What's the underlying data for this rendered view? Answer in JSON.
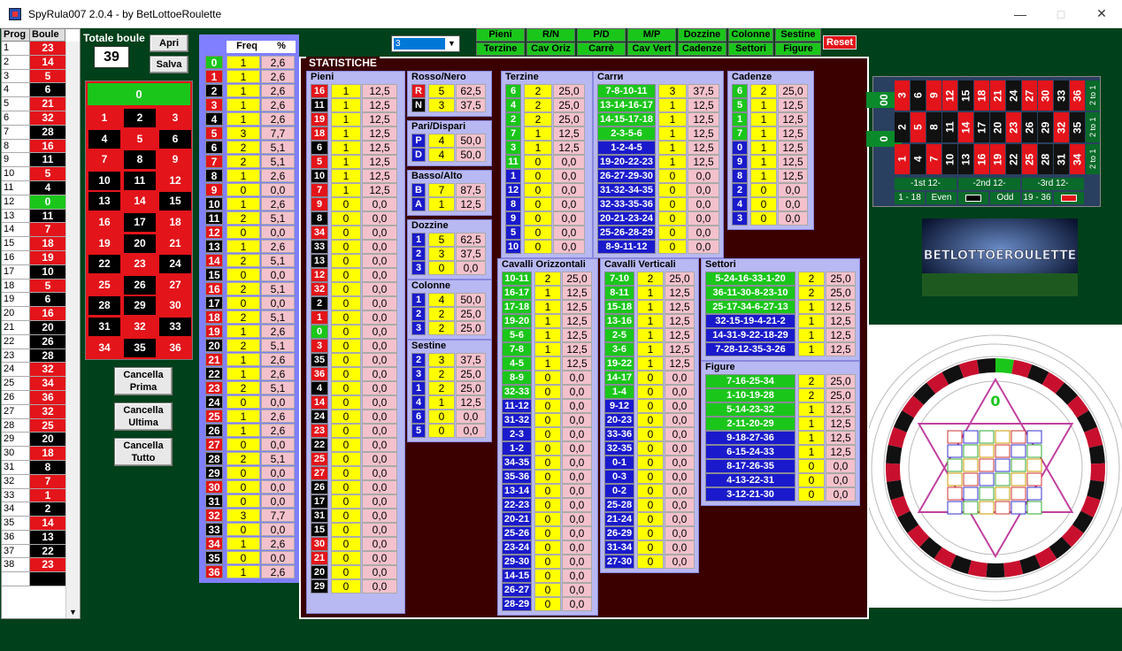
{
  "window": {
    "title": "SpyRula007 2.0.4 - by BetLottoeRoulette"
  },
  "left_grid": {
    "headers": [
      "Prog",
      "Boule"
    ],
    "rows": [
      [
        "1",
        "23",
        "r"
      ],
      [
        "2",
        "14",
        "r"
      ],
      [
        "3",
        "5",
        "r"
      ],
      [
        "4",
        "6",
        "b"
      ],
      [
        "5",
        "21",
        "r"
      ],
      [
        "6",
        "32",
        "r"
      ],
      [
        "7",
        "28",
        "b"
      ],
      [
        "8",
        "16",
        "r"
      ],
      [
        "9",
        "11",
        "b"
      ],
      [
        "10",
        "5",
        "r"
      ],
      [
        "11",
        "4",
        "b"
      ],
      [
        "12",
        "0",
        "g"
      ],
      [
        "13",
        "11",
        "b"
      ],
      [
        "14",
        "7",
        "r"
      ],
      [
        "15",
        "18",
        "r"
      ],
      [
        "16",
        "19",
        "r"
      ],
      [
        "17",
        "10",
        "b"
      ],
      [
        "18",
        "5",
        "r"
      ],
      [
        "19",
        "6",
        "b"
      ],
      [
        "20",
        "16",
        "r"
      ],
      [
        "21",
        "20",
        "b"
      ],
      [
        "22",
        "26",
        "b"
      ],
      [
        "23",
        "28",
        "b"
      ],
      [
        "24",
        "32",
        "r"
      ],
      [
        "25",
        "34",
        "r"
      ],
      [
        "26",
        "36",
        "r"
      ],
      [
        "27",
        "32",
        "r"
      ],
      [
        "28",
        "25",
        "r"
      ],
      [
        "29",
        "20",
        "b"
      ],
      [
        "30",
        "18",
        "r"
      ],
      [
        "31",
        "8",
        "b"
      ],
      [
        "32",
        "7",
        "r"
      ],
      [
        "33",
        "1",
        "r"
      ],
      [
        "34",
        "2",
        "b"
      ],
      [
        "35",
        "14",
        "r"
      ],
      [
        "36",
        "13",
        "b"
      ],
      [
        "37",
        "22",
        "b"
      ],
      [
        "38",
        "23",
        "r"
      ]
    ]
  },
  "controls": {
    "totale_label": "Totale boule",
    "totale_value": "39",
    "apri": "Apri",
    "salva": "Salva",
    "cancella_prima": "Cancella\nPrima",
    "cancella_ultima": "Cancella\nUltima",
    "cancella_tutto": "Cancella\nTutto"
  },
  "board": {
    "zero": "0",
    "rows": [
      [
        "1",
        "r"
      ],
      [
        "2",
        "b"
      ],
      [
        "3",
        "r"
      ],
      [
        "4",
        "b"
      ],
      [
        "5",
        "r"
      ],
      [
        "6",
        "b"
      ],
      [
        "7",
        "r"
      ],
      [
        "8",
        "b"
      ],
      [
        "9",
        "r"
      ],
      [
        "10",
        "b"
      ],
      [
        "11",
        "b"
      ],
      [
        "12",
        "r"
      ],
      [
        "13",
        "b"
      ],
      [
        "14",
        "r"
      ],
      [
        "15",
        "b"
      ],
      [
        "16",
        "r"
      ],
      [
        "17",
        "b"
      ],
      [
        "18",
        "r"
      ],
      [
        "19",
        "r"
      ],
      [
        "20",
        "b"
      ],
      [
        "21",
        "r"
      ],
      [
        "22",
        "b"
      ],
      [
        "23",
        "r"
      ],
      [
        "24",
        "b"
      ],
      [
        "25",
        "r"
      ],
      [
        "26",
        "b"
      ],
      [
        "27",
        "r"
      ],
      [
        "28",
        "b"
      ],
      [
        "29",
        "b"
      ],
      [
        "30",
        "r"
      ],
      [
        "31",
        "b"
      ],
      [
        "32",
        "r"
      ],
      [
        "33",
        "b"
      ],
      [
        "34",
        "r"
      ],
      [
        "35",
        "b"
      ],
      [
        "36",
        "r"
      ]
    ]
  },
  "freq": {
    "headers": [
      "Freq",
      "%"
    ],
    "rows": [
      [
        "0",
        "1",
        "2,6",
        "g"
      ],
      [
        "1",
        "1",
        "2,6",
        "r"
      ],
      [
        "2",
        "1",
        "2,6",
        "b"
      ],
      [
        "3",
        "1",
        "2,6",
        "r"
      ],
      [
        "4",
        "1",
        "2,6",
        "b"
      ],
      [
        "5",
        "3",
        "7,7",
        "r"
      ],
      [
        "6",
        "2",
        "5,1",
        "b"
      ],
      [
        "7",
        "2",
        "5,1",
        "r"
      ],
      [
        "8",
        "1",
        "2,6",
        "b"
      ],
      [
        "9",
        "0",
        "0,0",
        "r"
      ],
      [
        "10",
        "1",
        "2,6",
        "b"
      ],
      [
        "11",
        "2",
        "5,1",
        "b"
      ],
      [
        "12",
        "0",
        "0,0",
        "r"
      ],
      [
        "13",
        "1",
        "2,6",
        "b"
      ],
      [
        "14",
        "2",
        "5,1",
        "r"
      ],
      [
        "15",
        "0",
        "0,0",
        "b"
      ],
      [
        "16",
        "2",
        "5,1",
        "r"
      ],
      [
        "17",
        "0",
        "0,0",
        "b"
      ],
      [
        "18",
        "2",
        "5,1",
        "r"
      ],
      [
        "19",
        "1",
        "2,6",
        "r"
      ],
      [
        "20",
        "2",
        "5,1",
        "b"
      ],
      [
        "21",
        "1",
        "2,6",
        "r"
      ],
      [
        "22",
        "1",
        "2,6",
        "b"
      ],
      [
        "23",
        "2",
        "5,1",
        "r"
      ],
      [
        "24",
        "0",
        "0,0",
        "b"
      ],
      [
        "25",
        "1",
        "2,6",
        "r"
      ],
      [
        "26",
        "1",
        "2,6",
        "b"
      ],
      [
        "27",
        "0",
        "0,0",
        "r"
      ],
      [
        "28",
        "2",
        "5,1",
        "b"
      ],
      [
        "29",
        "0",
        "0,0",
        "b"
      ],
      [
        "30",
        "0",
        "0,0",
        "r"
      ],
      [
        "31",
        "0",
        "0,0",
        "b"
      ],
      [
        "32",
        "3",
        "7,7",
        "r"
      ],
      [
        "33",
        "0",
        "0,0",
        "b"
      ],
      [
        "34",
        "1",
        "2,6",
        "r"
      ],
      [
        "35",
        "0",
        "0,0",
        "b"
      ],
      [
        "36",
        "1",
        "2,6",
        "r"
      ]
    ]
  },
  "combo": {
    "value": "3"
  },
  "nav_buttons": [
    [
      "Pieni",
      "Terzine"
    ],
    [
      "R/N",
      "Cav Oriz"
    ],
    [
      "P/D",
      "Carrè"
    ],
    [
      "M/P",
      "Cav Vert"
    ],
    [
      "Dozzine",
      "Cadenze"
    ],
    [
      "Colonne",
      "Settori"
    ],
    [
      "Sestine",
      "Figure"
    ]
  ],
  "reset": "Reset",
  "stat_label": "STATISTICHE",
  "pieni": {
    "title": "Pieni",
    "rows": [
      [
        "16",
        "1",
        "12,5",
        "r"
      ],
      [
        "11",
        "1",
        "12,5",
        "b"
      ],
      [
        "19",
        "1",
        "12,5",
        "r"
      ],
      [
        "18",
        "1",
        "12,5",
        "r"
      ],
      [
        "6",
        "1",
        "12,5",
        "b"
      ],
      [
        "5",
        "1",
        "12,5",
        "r"
      ],
      [
        "10",
        "1",
        "12,5",
        "b"
      ],
      [
        "7",
        "1",
        "12,5",
        "r"
      ],
      [
        "9",
        "0",
        "0,0",
        "r"
      ],
      [
        "8",
        "0",
        "0,0",
        "b"
      ],
      [
        "34",
        "0",
        "0,0",
        "r"
      ],
      [
        "33",
        "0",
        "0,0",
        "b"
      ],
      [
        "13",
        "0",
        "0,0",
        "b"
      ],
      [
        "12",
        "0",
        "0,0",
        "r"
      ],
      [
        "32",
        "0",
        "0,0",
        "r"
      ],
      [
        "2",
        "0",
        "0,0",
        "b"
      ],
      [
        "1",
        "0",
        "0,0",
        "r"
      ],
      [
        "0",
        "0",
        "0,0",
        "g"
      ],
      [
        "3",
        "0",
        "0,0",
        "r"
      ],
      [
        "35",
        "0",
        "0,0",
        "b"
      ],
      [
        "36",
        "0",
        "0,0",
        "r"
      ],
      [
        "4",
        "0",
        "0,0",
        "b"
      ],
      [
        "14",
        "0",
        "0,0",
        "r"
      ],
      [
        "24",
        "0",
        "0,0",
        "b"
      ],
      [
        "23",
        "0",
        "0,0",
        "r"
      ],
      [
        "22",
        "0",
        "0,0",
        "b"
      ],
      [
        "25",
        "0",
        "0,0",
        "r"
      ],
      [
        "27",
        "0",
        "0,0",
        "r"
      ],
      [
        "26",
        "0",
        "0,0",
        "b"
      ],
      [
        "17",
        "0",
        "0,0",
        "b"
      ],
      [
        "31",
        "0",
        "0,0",
        "b"
      ],
      [
        "15",
        "0",
        "0,0",
        "b"
      ],
      [
        "30",
        "0",
        "0,0",
        "r"
      ],
      [
        "21",
        "0",
        "0,0",
        "r"
      ],
      [
        "20",
        "0",
        "0,0",
        "b"
      ],
      [
        "29",
        "0",
        "0,0",
        "b"
      ]
    ]
  },
  "rosso": {
    "title": "Rosso/Nero",
    "rows": [
      [
        "R",
        "5",
        "62,5",
        "r"
      ],
      [
        "N",
        "3",
        "37,5",
        "b"
      ]
    ]
  },
  "pari": {
    "title": "Pari/Dispari",
    "rows": [
      [
        "P",
        "4",
        "50,0",
        "u"
      ],
      [
        "D",
        "4",
        "50,0",
        "u"
      ]
    ]
  },
  "basso": {
    "title": "Basso/Alto",
    "rows": [
      [
        "B",
        "7",
        "87,5",
        "u"
      ],
      [
        "A",
        "1",
        "12,5",
        "u"
      ]
    ]
  },
  "dozzine": {
    "title": "Dozzine",
    "rows": [
      [
        "1",
        "5",
        "62,5",
        "u"
      ],
      [
        "2",
        "3",
        "37,5",
        "u"
      ],
      [
        "3",
        "0",
        "0,0",
        "u"
      ]
    ]
  },
  "colonne": {
    "title": "Colonne",
    "rows": [
      [
        "1",
        "4",
        "50,0",
        "u"
      ],
      [
        "2",
        "2",
        "25,0",
        "u"
      ],
      [
        "3",
        "2",
        "25,0",
        "u"
      ]
    ]
  },
  "sestine": {
    "title": "Sestine",
    "rows": [
      [
        "2",
        "3",
        "37,5",
        "u"
      ],
      [
        "3",
        "2",
        "25,0",
        "u"
      ],
      [
        "1",
        "2",
        "25,0",
        "u"
      ],
      [
        "4",
        "1",
        "12,5",
        "u"
      ],
      [
        "6",
        "0",
        "0,0",
        "u"
      ],
      [
        "5",
        "0",
        "0,0",
        "u"
      ]
    ]
  },
  "terzine": {
    "title": "Terzine",
    "rows": [
      [
        "6",
        "2",
        "25,0",
        "g"
      ],
      [
        "4",
        "2",
        "25,0",
        "g"
      ],
      [
        "2",
        "2",
        "25,0",
        "g"
      ],
      [
        "7",
        "1",
        "12,5",
        "g"
      ],
      [
        "3",
        "1",
        "12,5",
        "g"
      ],
      [
        "11",
        "0",
        "0,0",
        "g"
      ],
      [
        "1",
        "0",
        "0,0",
        "u"
      ],
      [
        "12",
        "0",
        "0,0",
        "u"
      ],
      [
        "8",
        "0",
        "0,0",
        "u"
      ],
      [
        "9",
        "0",
        "0,0",
        "u"
      ],
      [
        "5",
        "0",
        "0,0",
        "u"
      ],
      [
        "10",
        "0",
        "0,0",
        "u"
      ]
    ]
  },
  "carre": {
    "title": "Carrи",
    "rows": [
      [
        "7-8-10-11",
        "3",
        "37,5",
        "g"
      ],
      [
        "13-14-16-17",
        "1",
        "12,5",
        "g"
      ],
      [
        "14-15-17-18",
        "1",
        "12,5",
        "g"
      ],
      [
        "2-3-5-6",
        "1",
        "12,5",
        "g"
      ],
      [
        "1-2-4-5",
        "1",
        "12,5",
        "u"
      ],
      [
        "19-20-22-23",
        "1",
        "12,5",
        "u"
      ],
      [
        "26-27-29-30",
        "0",
        "0,0",
        "u"
      ],
      [
        "31-32-34-35",
        "0",
        "0,0",
        "u"
      ],
      [
        "32-33-35-36",
        "0",
        "0,0",
        "u"
      ],
      [
        "20-21-23-24",
        "0",
        "0,0",
        "u"
      ],
      [
        "25-26-28-29",
        "0",
        "0,0",
        "u"
      ],
      [
        "8-9-11-12",
        "0",
        "0,0",
        "u"
      ]
    ]
  },
  "cadenze": {
    "title": "Cadenze",
    "rows": [
      [
        "6",
        "2",
        "25,0",
        "g"
      ],
      [
        "5",
        "1",
        "12,5",
        "g"
      ],
      [
        "1",
        "1",
        "12,5",
        "g"
      ],
      [
        "7",
        "1",
        "12,5",
        "g"
      ],
      [
        "0",
        "1",
        "12,5",
        "u"
      ],
      [
        "9",
        "1",
        "12,5",
        "u"
      ],
      [
        "8",
        "1",
        "12,5",
        "u"
      ],
      [
        "2",
        "0",
        "0,0",
        "u"
      ],
      [
        "4",
        "0",
        "0,0",
        "u"
      ],
      [
        "3",
        "0",
        "0,0",
        "u"
      ]
    ]
  },
  "cav_oriz": {
    "title": "Cavalli Orizzontali",
    "rows": [
      [
        "10-11",
        "2",
        "25,0",
        "g"
      ],
      [
        "16-17",
        "1",
        "12,5",
        "g"
      ],
      [
        "17-18",
        "1",
        "12,5",
        "g"
      ],
      [
        "19-20",
        "1",
        "12,5",
        "g"
      ],
      [
        "5-6",
        "1",
        "12,5",
        "g"
      ],
      [
        "7-8",
        "1",
        "12,5",
        "g"
      ],
      [
        "4-5",
        "1",
        "12,5",
        "g"
      ],
      [
        "8-9",
        "0",
        "0,0",
        "g"
      ],
      [
        "32-33",
        "0",
        "0,0",
        "g"
      ],
      [
        "11-12",
        "0",
        "0,0",
        "u"
      ],
      [
        "31-32",
        "0",
        "0,0",
        "u"
      ],
      [
        "2-3",
        "0",
        "0,0",
        "u"
      ],
      [
        "1-2",
        "0",
        "0,0",
        "u"
      ],
      [
        "34-35",
        "0",
        "0,0",
        "u"
      ],
      [
        "35-36",
        "0",
        "0,0",
        "u"
      ],
      [
        "13-14",
        "0",
        "0,0",
        "u"
      ],
      [
        "22-23",
        "0",
        "0,0",
        "u"
      ],
      [
        "20-21",
        "0",
        "0,0",
        "u"
      ],
      [
        "25-26",
        "0",
        "0,0",
        "u"
      ],
      [
        "23-24",
        "0",
        "0,0",
        "u"
      ],
      [
        "29-30",
        "0",
        "0,0",
        "u"
      ],
      [
        "14-15",
        "0",
        "0,0",
        "u"
      ],
      [
        "26-27",
        "0",
        "0,0",
        "u"
      ],
      [
        "28-29",
        "0",
        "0,0",
        "u"
      ]
    ]
  },
  "cav_vert": {
    "title": "Cavalli Verticali",
    "rows": [
      [
        "7-10",
        "2",
        "25,0",
        "g"
      ],
      [
        "8-11",
        "1",
        "12,5",
        "g"
      ],
      [
        "15-18",
        "1",
        "12,5",
        "g"
      ],
      [
        "13-16",
        "1",
        "12,5",
        "g"
      ],
      [
        "2-5",
        "1",
        "12,5",
        "g"
      ],
      [
        "3-6",
        "1",
        "12,5",
        "g"
      ],
      [
        "19-22",
        "1",
        "12,5",
        "g"
      ],
      [
        "14-17",
        "0",
        "0,0",
        "g"
      ],
      [
        "1-4",
        "0",
        "0,0",
        "g"
      ],
      [
        "9-12",
        "0",
        "0,0",
        "u"
      ],
      [
        "20-23",
        "0",
        "0,0",
        "u"
      ],
      [
        "33-36",
        "0",
        "0,0",
        "u"
      ],
      [
        "32-35",
        "0",
        "0,0",
        "u"
      ],
      [
        "0-1",
        "0",
        "0,0",
        "u"
      ],
      [
        "0-3",
        "0",
        "0,0",
        "u"
      ],
      [
        "0-2",
        "0",
        "0,0",
        "u"
      ],
      [
        "25-28",
        "0",
        "0,0",
        "u"
      ],
      [
        "21-24",
        "0",
        "0,0",
        "u"
      ],
      [
        "26-29",
        "0",
        "0,0",
        "u"
      ],
      [
        "31-34",
        "0",
        "0,0",
        "u"
      ],
      [
        "27-30",
        "0",
        "0,0",
        "u"
      ]
    ]
  },
  "settori": {
    "title": "Settori",
    "rows": [
      [
        "5-24-16-33-1-20",
        "2",
        "25,0",
        "g"
      ],
      [
        "36-11-30-8-23-10",
        "2",
        "25,0",
        "g"
      ],
      [
        "25-17-34-6-27-13",
        "1",
        "12,5",
        "g"
      ],
      [
        "32-15-19-4-21-2",
        "1",
        "12,5",
        "u"
      ],
      [
        "14-31-9-22-18-29",
        "1",
        "12,5",
        "u"
      ],
      [
        "7-28-12-35-3-26",
        "1",
        "12,5",
        "u"
      ]
    ]
  },
  "figure": {
    "title": "Figure",
    "rows": [
      [
        "7-16-25-34",
        "2",
        "25,0",
        "g"
      ],
      [
        "1-10-19-28",
        "2",
        "25,0",
        "g"
      ],
      [
        "5-14-23-32",
        "1",
        "12,5",
        "g"
      ],
      [
        "2-11-20-29",
        "1",
        "12,5",
        "g"
      ],
      [
        "9-18-27-36",
        "1",
        "12,5",
        "u"
      ],
      [
        "6-15-24-33",
        "1",
        "12,5",
        "u"
      ],
      [
        "8-17-26-35",
        "0",
        "0,0",
        "u"
      ],
      [
        "4-13-22-31",
        "0",
        "0,0",
        "u"
      ],
      [
        "3-12-21-30",
        "0",
        "0,0",
        "u"
      ]
    ]
  },
  "roulette_table": {
    "zero": "0",
    "double_zero": "00",
    "col_label": "2 to 1",
    "dozens": [
      "-1st 12-",
      "-2nd 12-",
      "-3rd 12-"
    ],
    "outside": [
      "1 - 18",
      "Even",
      "Odd",
      "19 - 36"
    ],
    "grid": [
      [
        "3",
        "6",
        "9",
        "12",
        "15",
        "18",
        "21",
        "24",
        "27",
        "30",
        "33",
        "36"
      ],
      [
        "2",
        "5",
        "8",
        "11",
        "14",
        "17",
        "20",
        "23",
        "26",
        "29",
        "32",
        "35"
      ],
      [
        "1",
        "4",
        "7",
        "10",
        "13",
        "16",
        "19",
        "22",
        "25",
        "28",
        "31",
        "34"
      ]
    ]
  },
  "logo_text": "BETLOTTOEROULETTE",
  "wheel": {
    "center": "0"
  }
}
